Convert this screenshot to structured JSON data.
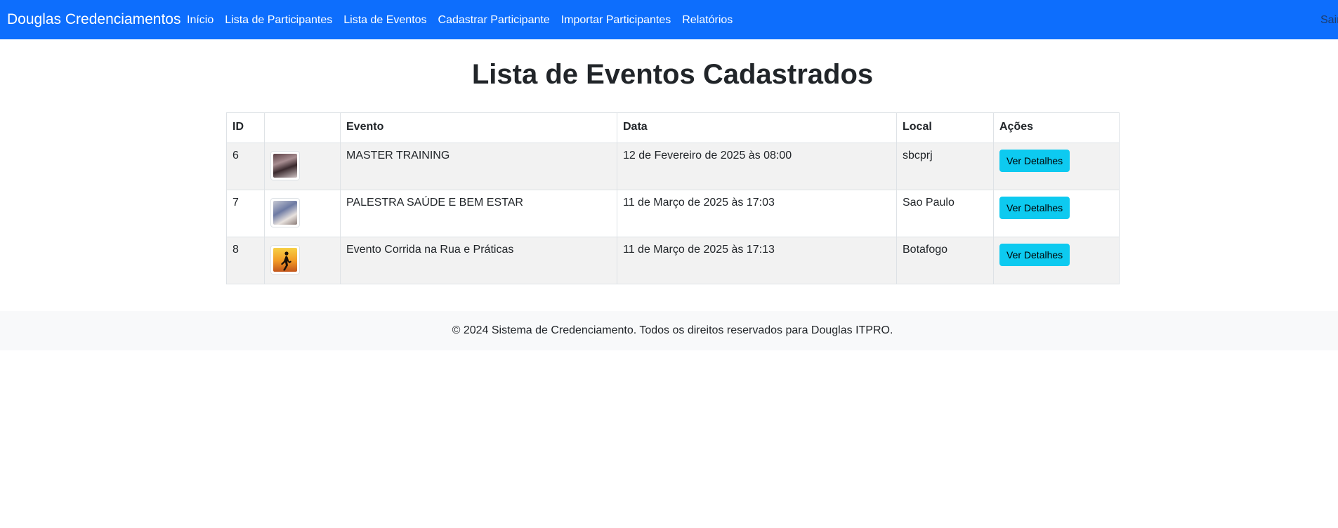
{
  "navbar": {
    "brand": "Douglas Credenciamentos",
    "links": [
      "Início",
      "Lista de Participantes",
      "Lista de Eventos",
      "Cadastrar Participante",
      "Importar Participantes",
      "Relatórios"
    ],
    "logout": "Sair",
    "color": "#0d6efd"
  },
  "page": {
    "title": "Lista de Eventos Cadastrados"
  },
  "table": {
    "headers": {
      "id": "ID",
      "image": "",
      "evento": "Evento",
      "data": "Data",
      "local": "Local",
      "acoes": "Ações"
    },
    "rows": [
      {
        "id": "6",
        "evento": "MASTER TRAINING",
        "data": "12 de Fevereiro de 2025 às 08:00",
        "local": "sbcprj",
        "action": "Ver Detalhes"
      },
      {
        "id": "7",
        "evento": "PALESTRA SAÚDE E BEM ESTAR",
        "data": "11 de Março de 2025 às 17:03",
        "local": "Sao Paulo",
        "action": "Ver Detalhes"
      },
      {
        "id": "8",
        "evento": "Evento Corrida na Rua e Práticas",
        "data": "11 de Março de 2025 às 17:13",
        "local": "Botafogo",
        "action": "Ver Detalhes"
      }
    ]
  },
  "footer": {
    "text": "© 2024 Sistema de Credenciamento. Todos os direitos reservados para Douglas ITPRO."
  },
  "colors": {
    "button": "#0dcaf0",
    "striped_row": "#f2f2f2",
    "footer_bg": "#f8f9fa"
  }
}
